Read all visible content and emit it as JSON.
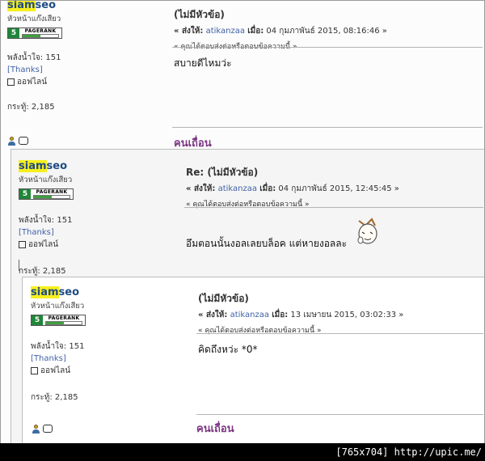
{
  "posts": [
    {
      "username_hl": "siam",
      "username_rest": "seo",
      "rank": "หัวหน้าแก๊งเสียว",
      "pagerank_num": "5",
      "pagerank_label": "PAGERANK",
      "pagerank_fill": 0.5,
      "karma": "พลังน้ำใจ: 151",
      "thanks": "[Thanks]",
      "online": "ออฟไลน์",
      "posts_count": "กระทู้: 2,185",
      "subject": "(ไม่มีหัวข้อ)",
      "meta_label_to": "« ส่งให้:",
      "meta_to": "atikanzaa",
      "meta_label_date": "เมื่อ:",
      "meta_date": "04 กุมภาพันธ์ 2015, 08:16:46 »",
      "quote": "« คุณได้ตอบส่งต่อหรือตอบข้อความนี้ »",
      "body": "สบายดีไหมว่ะ",
      "signature": "คนเถื่อน"
    },
    {
      "username_hl": "siam",
      "username_rest": "seo",
      "rank": "หัวหน้าแก๊งเสียว",
      "pagerank_num": "5",
      "pagerank_label": "PAGERANK",
      "pagerank_fill": 0.5,
      "karma": "พลังน้ำใจ: 151",
      "thanks": "[Thanks]",
      "online": "ออฟไลน์",
      "posts_count": "กระทู้: 2,185",
      "subject": "Re: (ไม่มีหัวข้อ)",
      "meta_label_to": "« ส่งให้:",
      "meta_to": "atikanzaa",
      "meta_label_date": "เมื่อ:",
      "meta_date": "04 กุมภาพันธ์ 2015, 12:45:45 »",
      "quote": "« คุณได้ตอบส่งต่อหรือตอบข้อความนี้ »",
      "body": "อึมตอนนั้นงอลเลยบล็อค แต่หายงอลละ"
    },
    {
      "username_hl": "siam",
      "username_rest": "seo",
      "rank": "หัวหน้าแก๊งเสียว",
      "pagerank_num": "5",
      "pagerank_label": "PAGERANK",
      "pagerank_fill": 0.5,
      "karma": "พลังน้ำใจ: 151",
      "thanks": "[Thanks]",
      "online": "ออฟไลน์",
      "posts_count": "กระทู้: 2,185",
      "subject": "(ไม่มีหัวข้อ)",
      "meta_label_to": "« ส่งให้:",
      "meta_to": "atikanzaa",
      "meta_label_date": "เมื่อ:",
      "meta_date": "13 เมษายน 2015, 03:02:33 »",
      "quote": "« คุณได้ตอบส่งต่อหรือตอบข้อความนี้ »",
      "body": "คิดถึงหว่ะ *0*",
      "signature": "คนเถื่อน"
    }
  ],
  "watermark": "[765x704] http://upic.me/"
}
